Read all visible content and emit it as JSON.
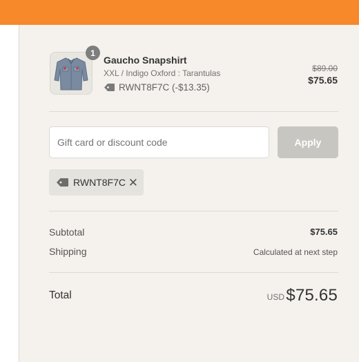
{
  "product": {
    "quantity": "1",
    "name": "Gaucho Snapshirt",
    "variant": "XXL / Indigo Oxford : Tarantulas",
    "discount_line": "RWNT8F7C (-$13.35)",
    "price_original": "$89.00",
    "price_final": "$75.65",
    "image_icon": "shirt-icon"
  },
  "discount": {
    "placeholder": "Gift card or discount code",
    "apply_label": "Apply",
    "applied_code": "RWNT8F7C",
    "remove_glyph": "✕"
  },
  "totals": {
    "subtotal_label": "Subtotal",
    "subtotal_value": "$75.65",
    "shipping_label": "Shipping",
    "shipping_value": "Calculated at next step",
    "total_label": "Total",
    "currency": "USD",
    "total_value": "$75.65"
  },
  "colors": {
    "header": "#f7892a",
    "summary_bg": "#f5f2ed",
    "button_disabled": "#c8c6c1"
  }
}
